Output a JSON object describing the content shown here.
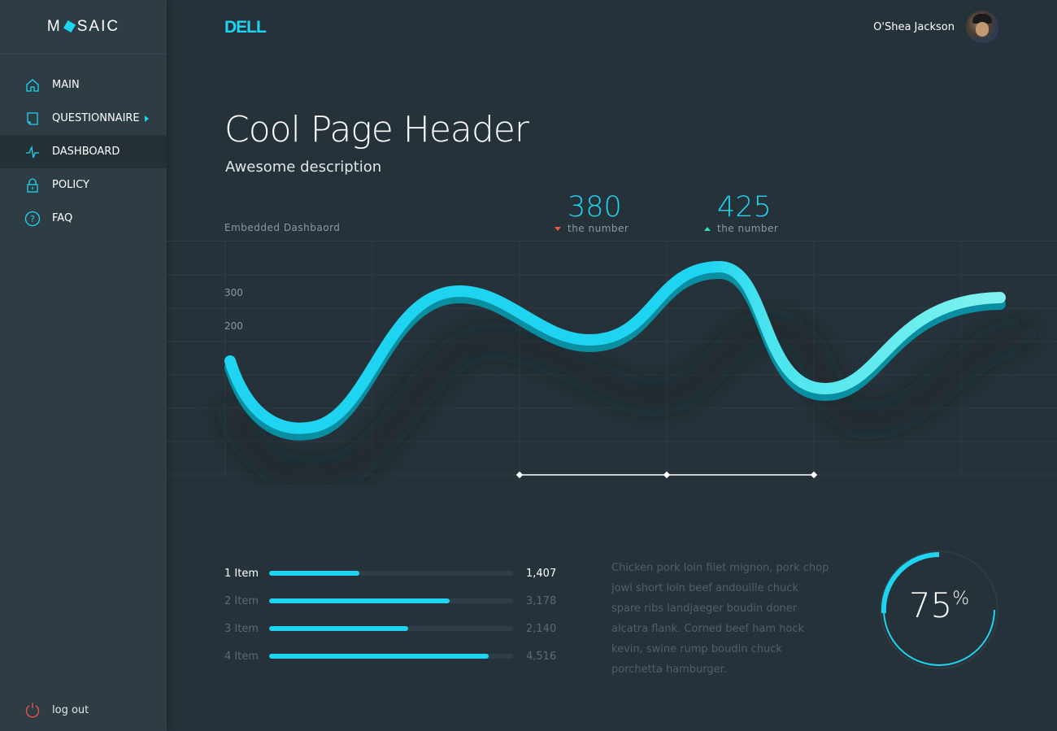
{
  "brand": {
    "app_name_left": "M",
    "app_name_right": "SAIC",
    "company": "DELL",
    "accent": "#1fd4f0"
  },
  "sidebar": {
    "items": [
      {
        "label": "MAIN",
        "icon": "home-icon"
      },
      {
        "label": "QUESTIONNAIRE",
        "icon": "document-icon"
      },
      {
        "label": "DASHBOARD",
        "icon": "pulse-icon"
      },
      {
        "label": "POLICY",
        "icon": "lock-icon"
      },
      {
        "label": "FAQ",
        "icon": "question-icon"
      }
    ],
    "logout": {
      "label": "log out",
      "icon": "power-icon",
      "color": "#e9564b"
    }
  },
  "header": {
    "user_name": "O'Shea Jackson"
  },
  "page": {
    "title": "Cool Page Header",
    "description": "Awesome description",
    "embed_label": "Embedded Dashbaord"
  },
  "stats": [
    {
      "value": "380",
      "label": "the number",
      "trend": "down",
      "color": "#e9564b"
    },
    {
      "value": "425",
      "label": "the number",
      "trend": "up",
      "color": "#2ee0b8"
    }
  ],
  "chart_data": {
    "type": "line",
    "y_ticks": [
      "300",
      "200"
    ],
    "grid": true
  },
  "progress": [
    {
      "label": "1 Item",
      "value": "1,407",
      "fraction": 0.37
    },
    {
      "label": "2 Item",
      "value": "3,178",
      "fraction": 0.74
    },
    {
      "label": "3 Item",
      "value": "2,140",
      "fraction": 0.57
    },
    {
      "label": "4 Item",
      "value": "4,516",
      "fraction": 0.9
    }
  ],
  "paragraph": "Chicken pork loin filet mignon, pork chop jowl short loin beef andouille chuck spare ribs landjaeger boudin doner alcatra flank. Corned beef ham hock kevin, swine rump boudin chuck porchetta hamburger.",
  "ring": {
    "value": "75",
    "unit": "%",
    "fraction": 0.75
  }
}
